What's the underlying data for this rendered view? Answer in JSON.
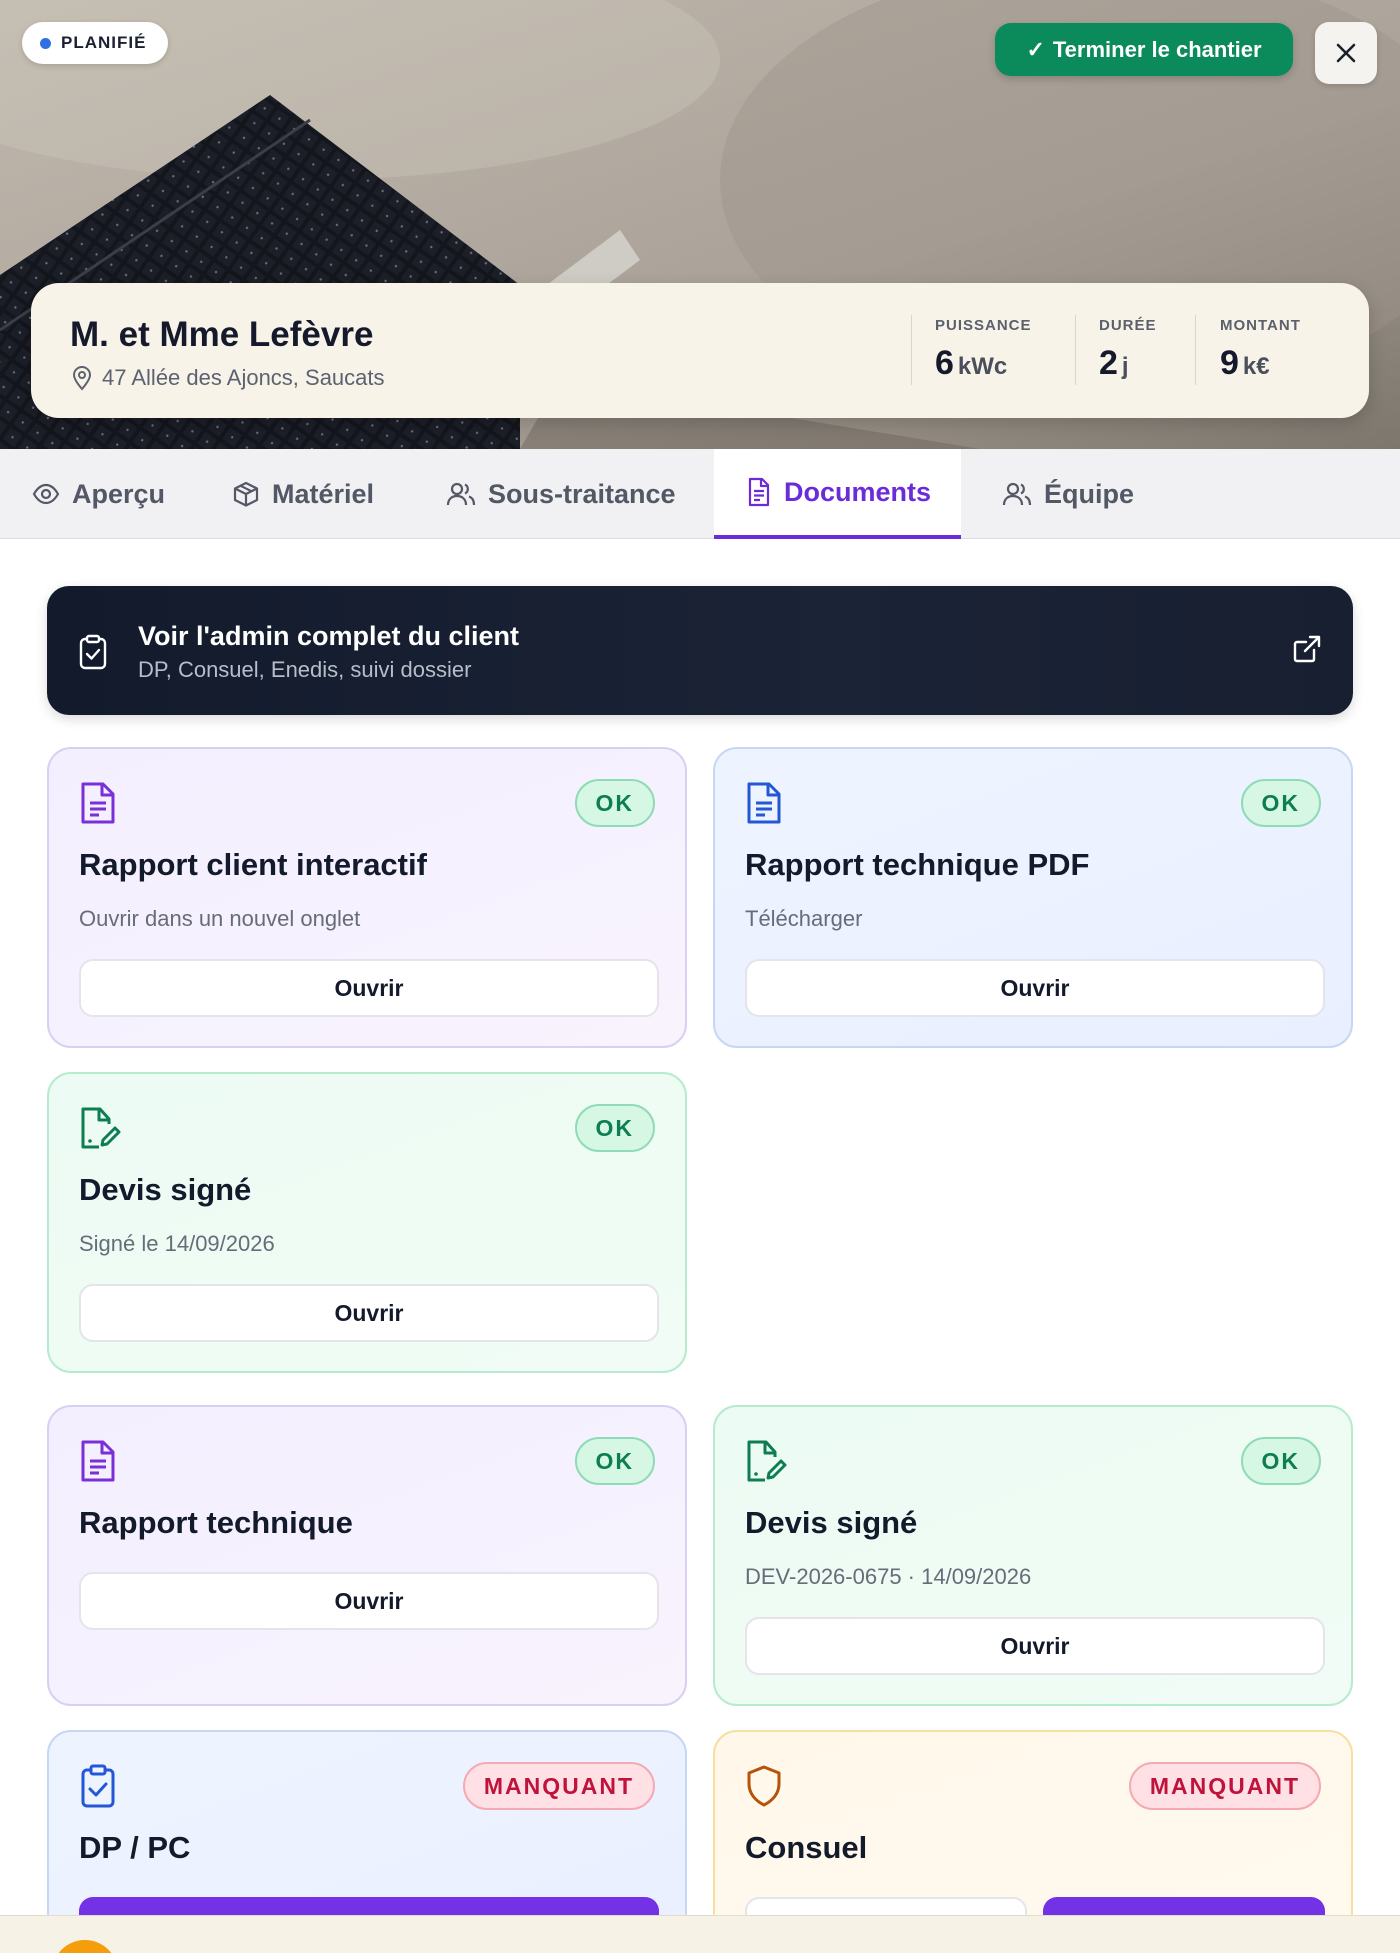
{
  "hero": {
    "status": "PLANIFIÉ",
    "finish_button": "Terminer le chantier",
    "finish_check": "✓",
    "client_name": "M. et Mme Lefèvre",
    "address": "47 Allée des Ajoncs, Saucats",
    "stats": [
      {
        "label": "PUISSANCE",
        "value": "6",
        "unit": "kWc"
      },
      {
        "label": "DURÉE",
        "value": "2",
        "unit": "j"
      },
      {
        "label": "MONTANT",
        "value": "9",
        "unit": "k€"
      }
    ]
  },
  "tabs": [
    {
      "label": "Aperçu",
      "icon": "eye-icon"
    },
    {
      "label": "Matériel",
      "icon": "box-icon"
    },
    {
      "label": "Sous-traitance",
      "icon": "users-icon"
    },
    {
      "label": "Documents",
      "icon": "file-icon",
      "active": true
    },
    {
      "label": "Équipe",
      "icon": "users-icon"
    }
  ],
  "admin_banner": {
    "title": "Voir l'admin complet du client",
    "subtitle": "DP, Consuel, Enedis, suivi dossier"
  },
  "documents": [
    {
      "title": "Rapport client interactif",
      "subtitle": "Ouvrir dans un nouvel onglet",
      "status": "OK",
      "button": "Ouvrir",
      "icon": "file-text-icon"
    },
    {
      "title": "Rapport technique PDF",
      "subtitle": "Télécharger",
      "status": "OK",
      "button": "Ouvrir",
      "icon": "file-text-icon"
    },
    {
      "title": "Devis signé",
      "subtitle": "Signé le 14/09/2026",
      "status": "OK",
      "button": "Ouvrir",
      "icon": "file-signature-icon"
    },
    {
      "title": "Rapport technique",
      "subtitle": "",
      "status": "OK",
      "button": "Ouvrir",
      "icon": "file-text-icon"
    },
    {
      "title": "Devis signé",
      "subtitle": "DEV-2026-0675 · 14/09/2026",
      "status": "OK",
      "button": "Ouvrir",
      "icon": "file-signature-icon"
    },
    {
      "title": "DP / PC",
      "subtitle": "",
      "status": "MANQUANT",
      "icon": "clipboard-check-icon"
    },
    {
      "title": "Consuel",
      "subtitle": "",
      "status": "MANQUANT",
      "icon": "shield-icon"
    }
  ],
  "colors": {
    "accent": "#6c2bd9",
    "success": "#0b8a5c",
    "danger": "#c0133c",
    "banner": "#121a2c"
  }
}
